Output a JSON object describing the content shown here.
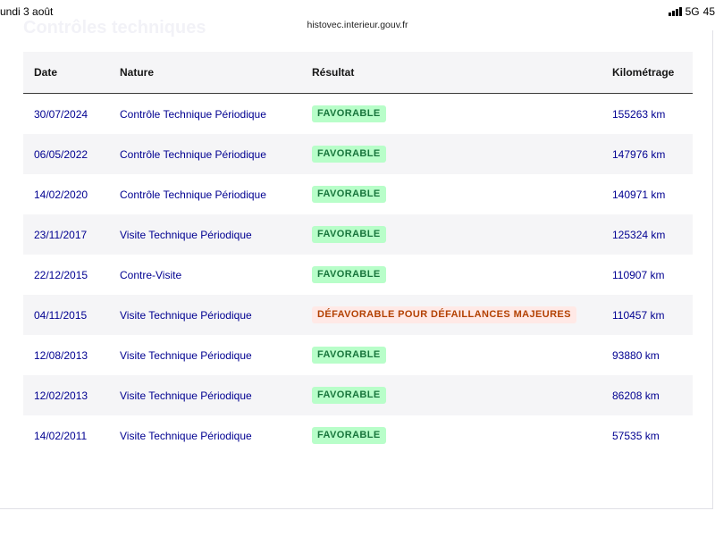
{
  "status_bar": {
    "date": "undi 3 août",
    "network": "5G",
    "battery": "45",
    "url": "histovec.interieur.gouv.fr"
  },
  "section_title": "Contrôles techniques",
  "table": {
    "headers": {
      "date": "Date",
      "nature": "Nature",
      "result": "Résultat",
      "mileage": "Kilométrage"
    },
    "rows": [
      {
        "date": "30/07/2024",
        "nature": "Contrôle Technique Périodique",
        "result": "FAVORABLE",
        "status": "ok",
        "mileage": "155263 km"
      },
      {
        "date": "06/05/2022",
        "nature": "Contrôle Technique Périodique",
        "result": "FAVORABLE",
        "status": "ok",
        "mileage": "147976 km"
      },
      {
        "date": "14/02/2020",
        "nature": "Contrôle Technique Périodique",
        "result": "FAVORABLE",
        "status": "ok",
        "mileage": "140971 km"
      },
      {
        "date": "23/11/2017",
        "nature": "Visite Technique Périodique",
        "result": "FAVORABLE",
        "status": "ok",
        "mileage": "125324 km"
      },
      {
        "date": "22/12/2015",
        "nature": "Contre-Visite",
        "result": "FAVORABLE",
        "status": "ok",
        "mileage": "110907 km"
      },
      {
        "date": "04/11/2015",
        "nature": "Visite Technique Périodique",
        "result": "DÉFAVORABLE POUR DÉFAILLANCES MAJEURES",
        "status": "ko",
        "mileage": "110457 km"
      },
      {
        "date": "12/08/2013",
        "nature": "Visite Technique Périodique",
        "result": "FAVORABLE",
        "status": "ok",
        "mileage": "93880 km"
      },
      {
        "date": "12/02/2013",
        "nature": "Visite Technique Périodique",
        "result": "FAVORABLE",
        "status": "ok",
        "mileage": "86208 km"
      },
      {
        "date": "14/02/2011",
        "nature": "Visite Technique Périodique",
        "result": "FAVORABLE",
        "status": "ok",
        "mileage": "57535 km"
      }
    ]
  },
  "colors": {
    "link_blue": "#000091",
    "favorable_bg": "#b8fec9",
    "favorable_text": "#18753c",
    "defavorable_bg": "#ffe9e6",
    "defavorable_text": "#b34000"
  }
}
